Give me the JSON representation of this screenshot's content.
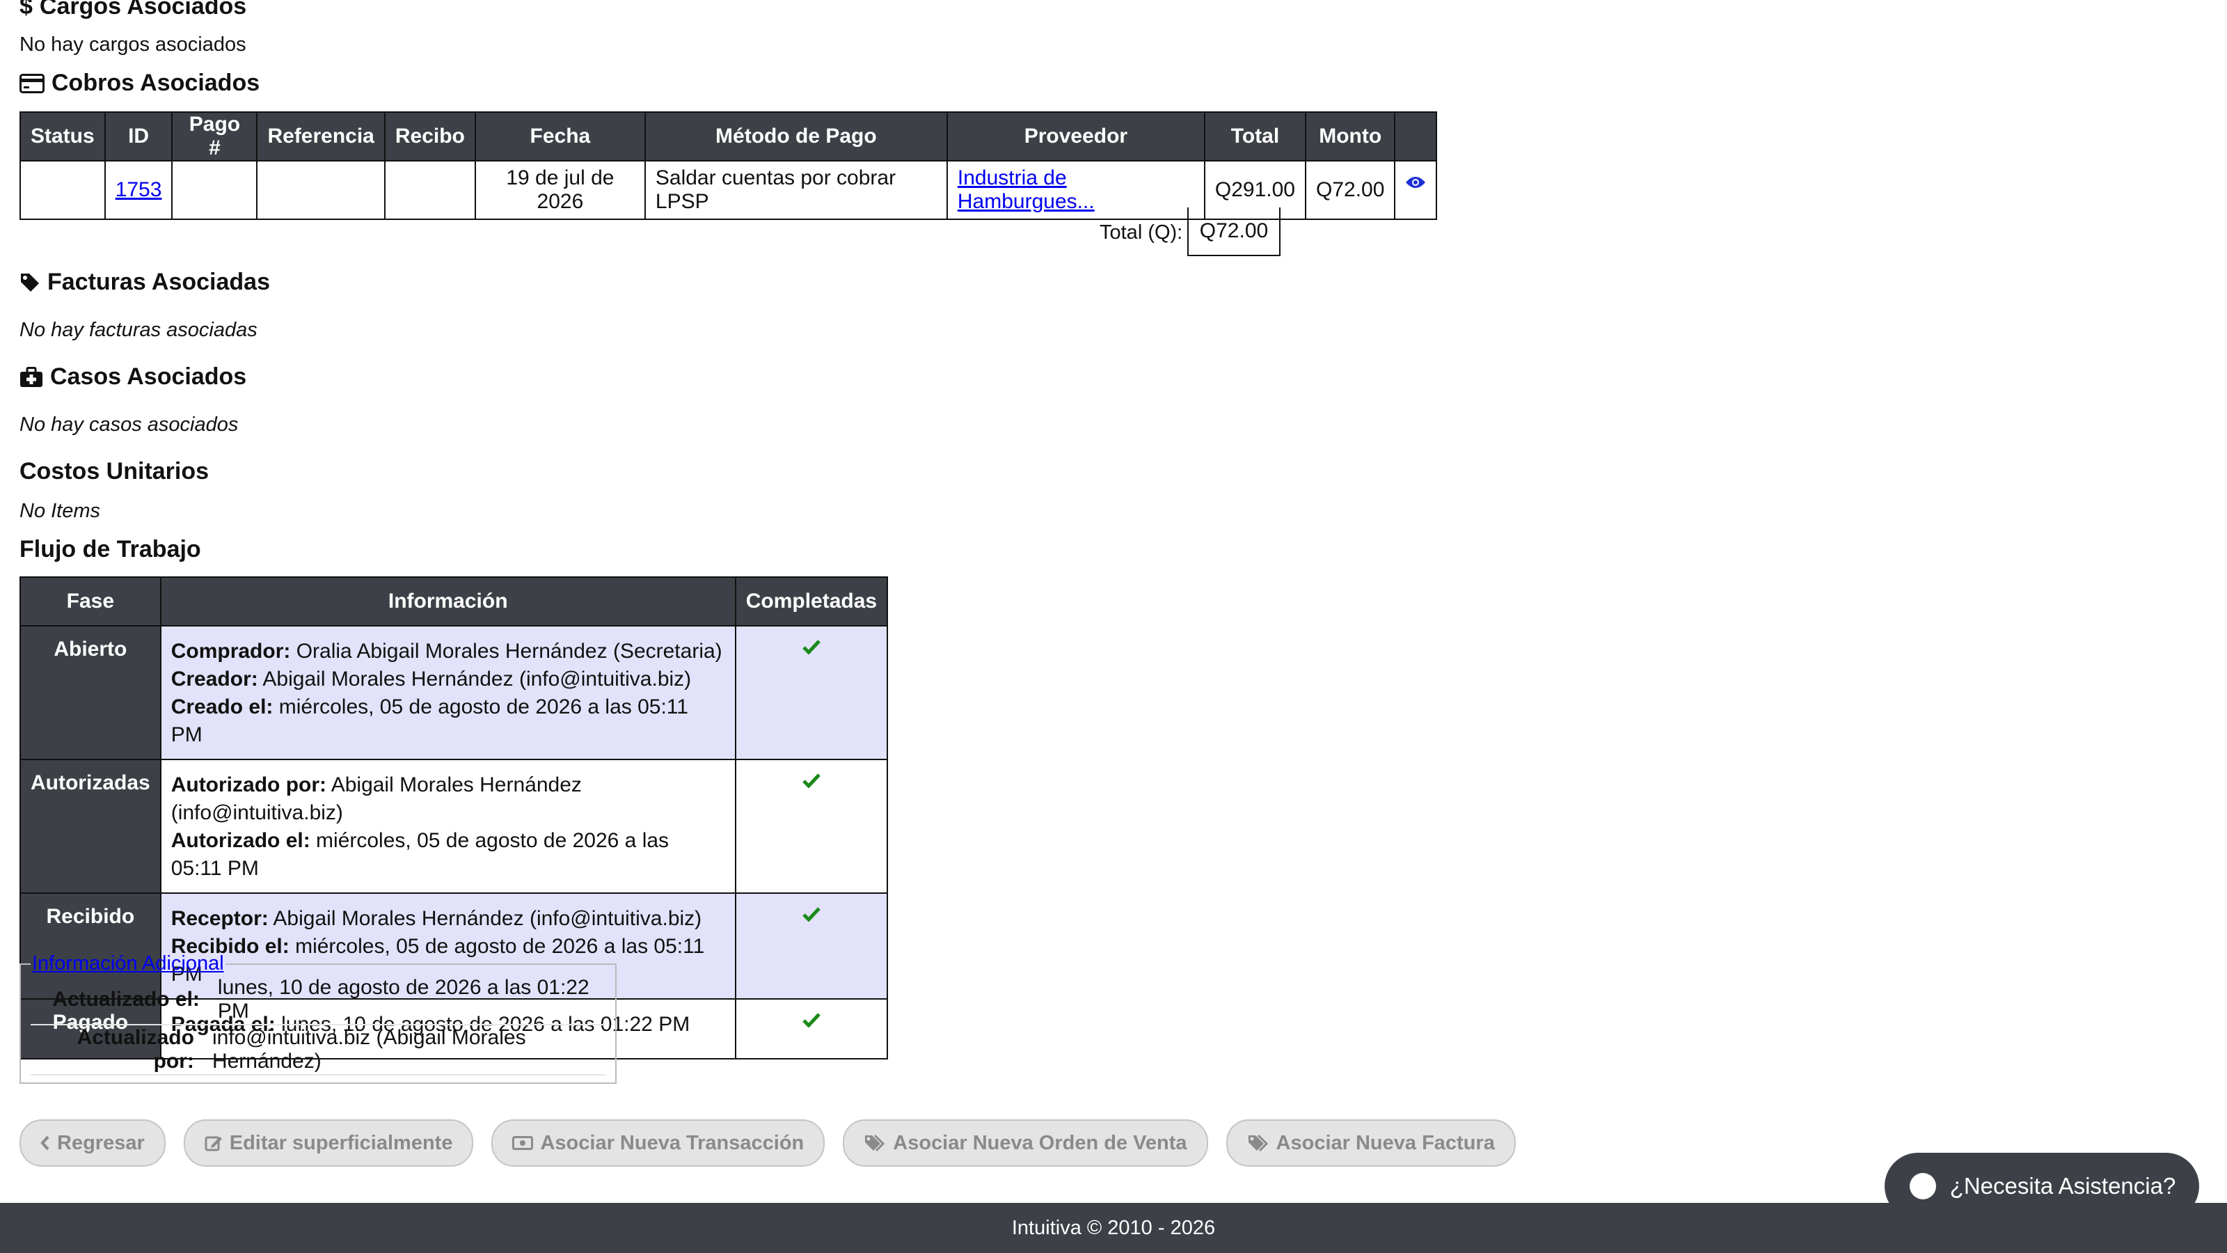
{
  "cargos": {
    "title": "Cargos Asociados",
    "empty": "No hay cargos asociados"
  },
  "cobros": {
    "title": "Cobros Asociados",
    "headers": [
      "Status",
      "ID",
      "Pago #",
      "Referencia",
      "Recibo",
      "Fecha",
      "Método de Pago",
      "Proveedor",
      "Total",
      "Monto"
    ],
    "row": {
      "status": "",
      "id": "1753",
      "pago": "",
      "referencia": "",
      "recibo": "",
      "fecha": "19 de jul de 2026",
      "metodo": "Saldar cuentas por cobrar LPSP",
      "proveedor": "Industria de Hamburgues...",
      "total": "Q291.00",
      "monto": "Q72.00"
    },
    "total_label": "Total (Q):",
    "total_value": "Q72.00"
  },
  "facturas": {
    "title": "Facturas Asociadas",
    "empty": "No hay facturas asociadas"
  },
  "casos": {
    "title": "Casos Asociados",
    "empty": "No hay casos asociados"
  },
  "costos": {
    "title": "Costos Unitarios",
    "empty": "No Items"
  },
  "flujo": {
    "title": "Flujo de Trabajo",
    "headers": [
      "Fase",
      "Información",
      "Completadas"
    ],
    "rows": [
      {
        "fase": "Abierto",
        "lines": [
          {
            "label": "Comprador:",
            "value": "Oralia Abigail Morales Hernández (Secretaria)"
          },
          {
            "label": "Creador:",
            "value": "Abigail Morales Hernández (info@intuitiva.biz)"
          },
          {
            "label": "Creado el:",
            "value": "miércoles, 05 de agosto de 2026 a las 05:11 PM"
          }
        ]
      },
      {
        "fase": "Autorizadas",
        "lines": [
          {
            "label": "Autorizado por:",
            "value": "Abigail Morales Hernández (info@intuitiva.biz)"
          },
          {
            "label": "Autorizado el:",
            "value": "miércoles, 05 de agosto de 2026 a las 05:11 PM"
          }
        ]
      },
      {
        "fase": "Recibido",
        "lines": [
          {
            "label": "Receptor:",
            "value": "Abigail Morales Hernández (info@intuitiva.biz)"
          },
          {
            "label": "Recibido el:",
            "value": "miércoles, 05 de agosto de 2026 a las 05:11 PM"
          }
        ]
      },
      {
        "fase": "Pagado",
        "lines": [
          {
            "label": "Pagada el:",
            "value": "lunes, 10 de agosto de 2026 a las 01:22 PM"
          }
        ]
      }
    ]
  },
  "info_adicional": {
    "legend": "Información Adicional",
    "rows": [
      {
        "label": "Actualizado el:",
        "value": "lunes, 10 de agosto de 2026 a las 01:22 PM"
      },
      {
        "label": "Actualizado por:",
        "value": "info@intuitiva.biz (Abigail Morales Hernández)"
      }
    ]
  },
  "buttons": {
    "regresar": "Regresar",
    "editar": "Editar superficialmente",
    "transaccion": "Asociar Nueva Transacción",
    "orden": "Asociar Nueva Orden de Venta",
    "factura": "Asociar Nueva Factura"
  },
  "help": "¿Necesita Asistencia?",
  "footer": "Intuitiva © 2010 - 2026",
  "colors": {
    "header_bg": "#3d4147",
    "shade": "#e2e2fb",
    "check": "#1a8a1a",
    "link": "#0000ee"
  }
}
